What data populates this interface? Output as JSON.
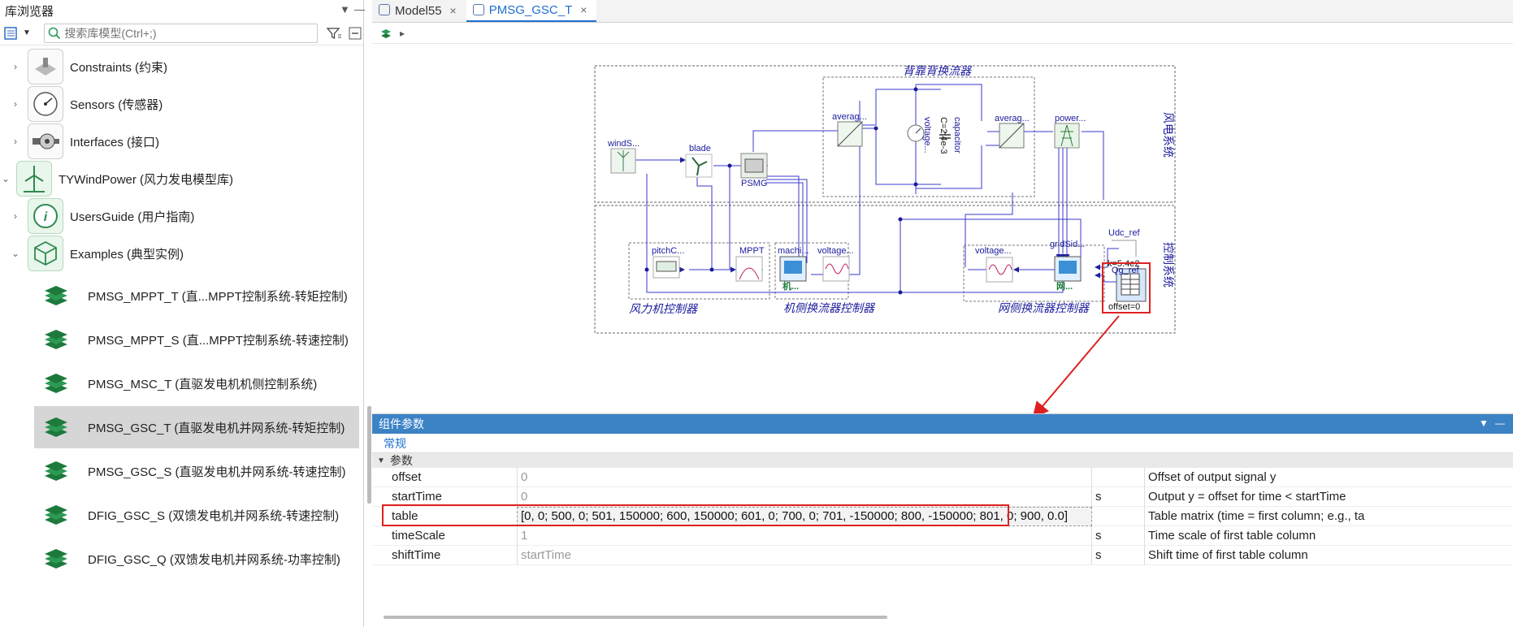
{
  "library": {
    "title": "库浏览器",
    "title_controls": {
      "dropdown": "▼",
      "minimize": "—"
    },
    "search_placeholder": "搜索库模型(Ctrl+;)",
    "items": [
      {
        "label": "Constraints (约束)",
        "expand": "›",
        "icon": "constraints-icon"
      },
      {
        "label": "Sensors (传感器)",
        "expand": "›",
        "icon": "sensors-icon"
      },
      {
        "label": "Interfaces (接口)",
        "expand": "›",
        "icon": "interfaces-icon"
      },
      {
        "label": "TYWindPower (风力发电模型库)",
        "expand": "⌄",
        "icon": "wind-turbine-icon"
      },
      {
        "label": "UsersGuide (用户指南)",
        "expand": "›",
        "icon": "info-icon"
      },
      {
        "label": "Examples (典型实例)",
        "expand": "⌄",
        "icon": "examples-icon"
      },
      {
        "label": "PMSG_MPPT_T (直...MPPT控制系统-转矩控制)",
        "icon": "layer-icon"
      },
      {
        "label": "PMSG_MPPT_S (直...MPPT控制系统-转速控制)",
        "icon": "layer-icon"
      },
      {
        "label": "PMSG_MSC_T (直驱发电机机侧控制系统)",
        "icon": "layer-icon"
      },
      {
        "label": "PMSG_GSC_T (直驱发电机并网系统-转矩控制)",
        "icon": "layer-icon",
        "selected": true
      },
      {
        "label": "PMSG_GSC_S (直驱发电机并网系统-转速控制)",
        "icon": "layer-icon"
      },
      {
        "label": "DFIG_GSC_S (双馈发电机并网系统-转速控制)",
        "icon": "layer-icon"
      },
      {
        "label": "DFIG_GSC_Q (双馈发电机并网系统-功率控制)",
        "icon": "layer-icon"
      }
    ]
  },
  "tabs": [
    {
      "label": "Model55",
      "close": "×",
      "active": false
    },
    {
      "label": "PMSG_GSC_T",
      "close": "×",
      "active": true
    }
  ],
  "diagram": {
    "groups": {
      "back_to_back": "背靠背换流器",
      "wind_system": "风电系统",
      "control_system": "控制系统",
      "turbine_ctrl": "风力机控制器",
      "msc_ctrl": "机侧换流器控制器",
      "gsc_ctrl": "网侧换流器控制器"
    },
    "blocks": {
      "wind": "windS...",
      "blade": "blade",
      "psmg": "PSMG",
      "avg1": "averag...",
      "voltage1": "voltage...",
      "capacitor": "capacitor",
      "cap_value": "C=2.4e-3",
      "avg2": "averag...",
      "power": "power...",
      "pitch": "pitchC...",
      "mppt": "MPPT",
      "machi": "machi...",
      "machi_sub": "机...",
      "voltage2": "voltage...",
      "voltage3": "voltage...",
      "grid": "gridSid...",
      "grid_sub": "网...",
      "udc": "Udc_ref",
      "k": "k=5.4e2",
      "qg": "Qg_ref",
      "offset": "offset=0"
    }
  },
  "panel": {
    "title": "组件参数",
    "controls": {
      "dropdown": "▼",
      "minimize": "—"
    },
    "tab": "常规",
    "group": "参数",
    "params": [
      {
        "name": "offset",
        "value": "0",
        "unit": "",
        "desc": "Offset of output signal y"
      },
      {
        "name": "startTime",
        "value": "0",
        "unit": "s",
        "desc": "Output y = offset for time < startTime"
      },
      {
        "name": "table",
        "value": "[0, 0; 500, 0; 501, 150000; 600, 150000; 601, 0; 700, 0; 701, -150000; 800, -150000; 801, 0; 900, 0.0]",
        "unit": "",
        "desc": "Table matrix (time = first column; e.g., ta"
      },
      {
        "name": "timeScale",
        "value": "1",
        "unit": "s",
        "desc": "Time scale of first table column"
      },
      {
        "name": "shiftTime",
        "value": "startTime",
        "unit": "s",
        "desc": "Shift time of first table column"
      }
    ]
  },
  "colors": {
    "accent": "#1f6fd1",
    "wire": "#3a3acf",
    "highlight": "#e02020",
    "panel_header": "#3c83c6"
  }
}
